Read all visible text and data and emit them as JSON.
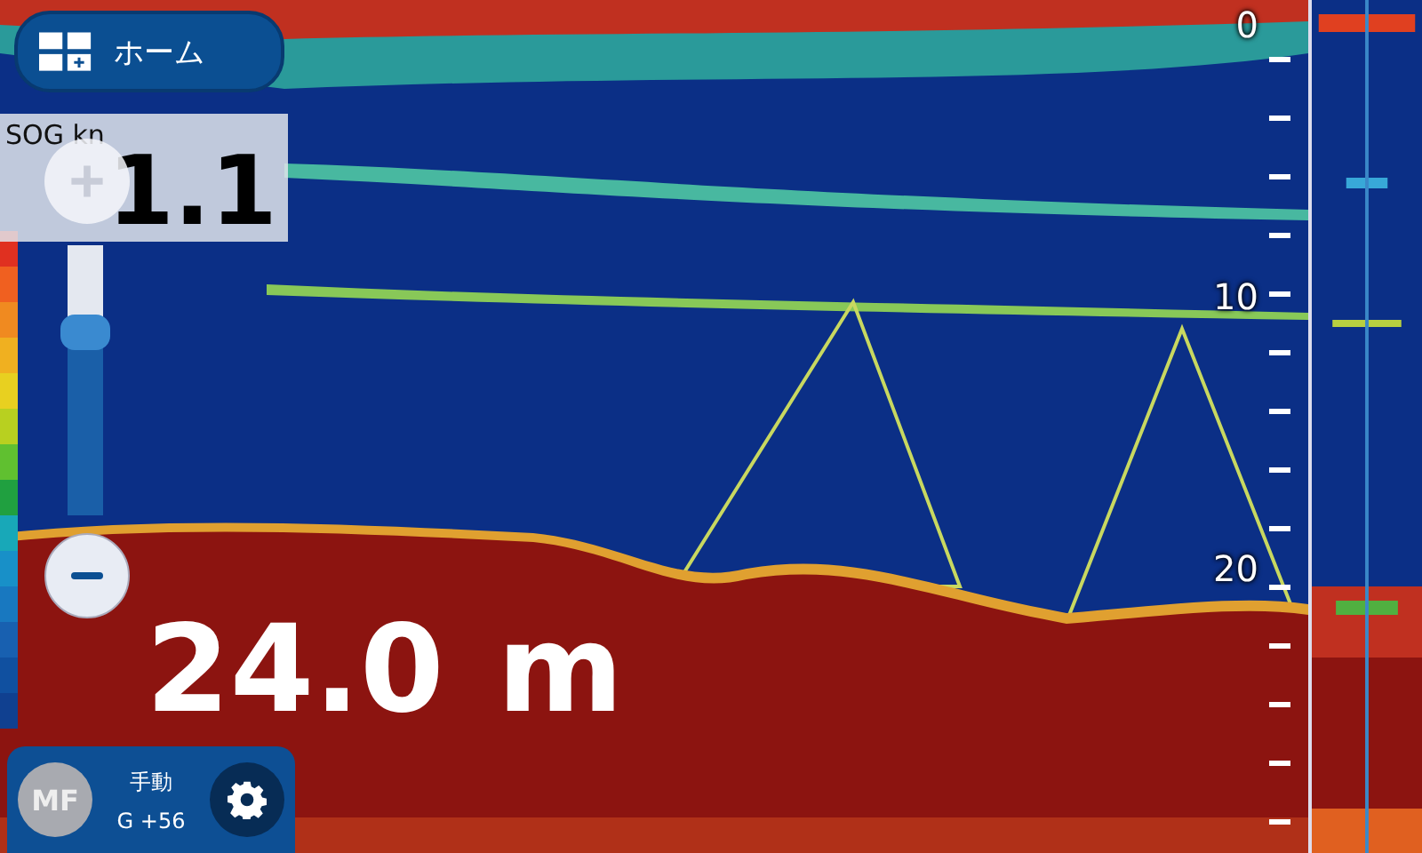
{
  "home_button": {
    "label": "ホーム"
  },
  "sog": {
    "label": "SOG kn",
    "value": "1.1"
  },
  "zoom": {
    "level": 0.68
  },
  "depth": {
    "value": "24.0",
    "unit": "m"
  },
  "depth_scale": {
    "labels": [
      "0",
      "10",
      "20"
    ]
  },
  "mode_panel": {
    "avatar": "MF",
    "mode": "手動",
    "gain": "G +56"
  }
}
